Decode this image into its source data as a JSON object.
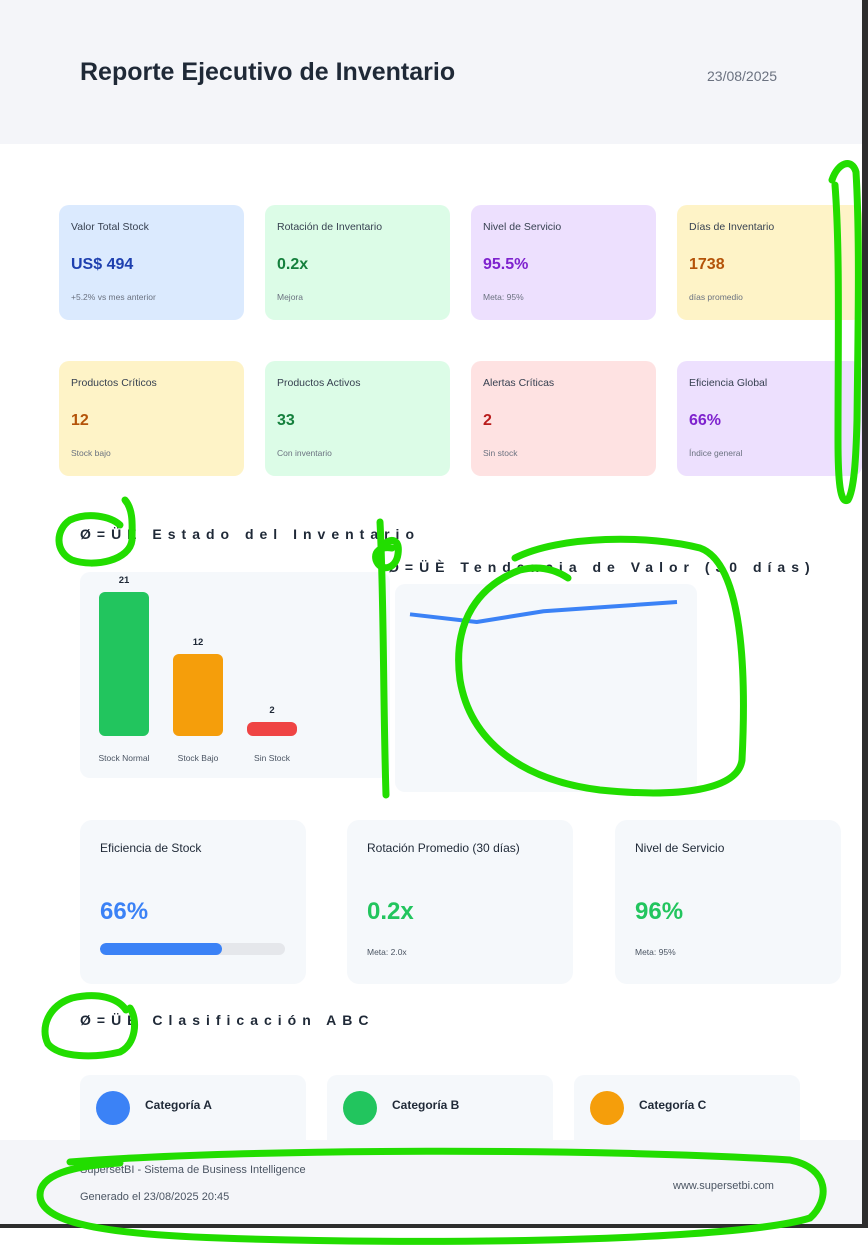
{
  "header": {
    "title": "Reporte Ejecutivo de Inventario",
    "date": "23/08/2025"
  },
  "kpis_row1": [
    {
      "label": "Valor Total Stock",
      "value": "US$ 494",
      "sub": "+5.2% vs mes anterior"
    },
    {
      "label": "Rotación de Inventario",
      "value": "0.2x",
      "sub": "Mejora"
    },
    {
      "label": "Nivel de Servicio",
      "value": "95.5%",
      "sub": "Meta: 95%"
    },
    {
      "label": "Días de Inventario",
      "value": "1738",
      "sub": "días promedio"
    }
  ],
  "kpis_row2": [
    {
      "label": "Productos Críticos",
      "value": "12",
      "sub": "Stock bajo"
    },
    {
      "label": "Productos Activos",
      "value": "33",
      "sub": "Con inventario"
    },
    {
      "label": "Alertas Críticas",
      "value": "2",
      "sub": "Sin stock"
    },
    {
      "label": "Eficiencia Global",
      "value": "66%",
      "sub": "Índice general"
    }
  ],
  "sections": {
    "estado": "Ø=ÜÊ Estado del Inventario",
    "tendencia": "Ø=ÜÈ Tendencia de Valor (30 días)",
    "abc": "Ø=ÜÊ Clasificación ABC"
  },
  "chart_data": [
    {
      "type": "bar",
      "categories": [
        "Stock Normal",
        "Stock Bajo",
        "Sin Stock"
      ],
      "values": [
        21,
        12,
        2
      ],
      "data_labels": [
        "21",
        "12",
        "2"
      ],
      "colors": [
        "#22c55e",
        "#f59e0b",
        "#ef4444"
      ],
      "title": "",
      "xlabel": "",
      "ylabel": "",
      "grid": false
    },
    {
      "type": "line",
      "x": [
        1,
        2,
        3,
        4,
        5
      ],
      "series": [
        {
          "values": [
            494,
            489,
            496,
            499,
            502
          ]
        }
      ],
      "color": "#3b82f6",
      "title": "",
      "xlabel": "",
      "ylabel": "",
      "grid": false
    }
  ],
  "metrics": [
    {
      "label": "Eficiencia de Stock",
      "value": "66%",
      "progress": 0.66,
      "color": "#3b82f6"
    },
    {
      "label": "Rotación Promedio (30 días)",
      "value": "0.2x",
      "sub": "Meta: 2.0x",
      "color": "#22c55e"
    },
    {
      "label": "Nivel de Servicio",
      "value": "96%",
      "sub": "Meta: 95%",
      "color": "#22c55e"
    }
  ],
  "abc": [
    {
      "label": "Categoría A",
      "color": "#3b82f6"
    },
    {
      "label": "Categoría B",
      "color": "#22c55e"
    },
    {
      "label": "Categoría C",
      "color": "#f59e0b"
    }
  ],
  "footer": {
    "line1": "SupersetBI - Sistema de Business Intelligence",
    "line2": "Generado el 23/08/2025 20:45",
    "url": "www.supersetbi.com"
  },
  "colors": {
    "annotation": "#22dd00"
  }
}
